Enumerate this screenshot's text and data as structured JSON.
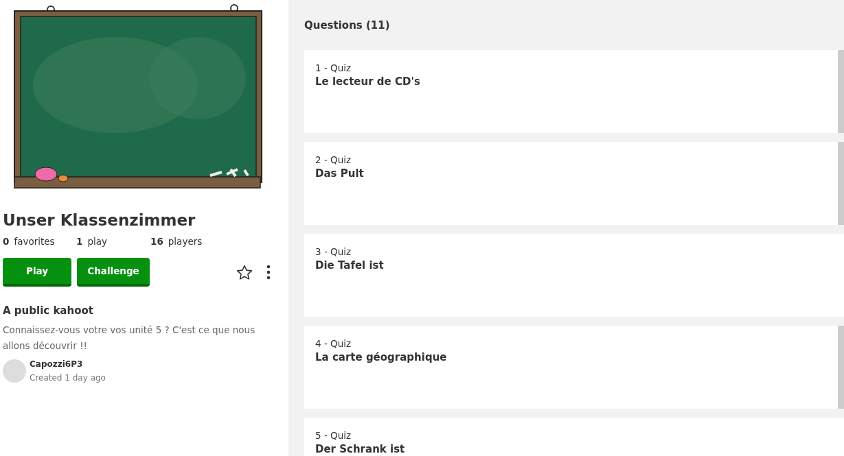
{
  "kahoot": {
    "title": "Unser Klassenzimmer",
    "stats": [
      {
        "count": "0",
        "label": "favorites"
      },
      {
        "count": "1",
        "label": "play"
      },
      {
        "count": "16",
        "label": "players"
      }
    ],
    "buttons": [
      "Play",
      "Challenge"
    ],
    "favorited": false,
    "visibility": "A public kahoot",
    "description": "Connaissez-vous votre vos unité 5 ? C'est ce que nous allons découvrir !!",
    "author": {
      "name": "Capozzi6P3",
      "created": "Created 1 day ago"
    }
  },
  "questions": {
    "heading": "Questions (11)",
    "items": [
      {
        "type": "1 - Quiz",
        "title": "Le lecteur de CD's",
        "thumbnail": true
      },
      {
        "type": "2 - Quiz",
        "title": "Das Pult",
        "thumbnail": true
      },
      {
        "type": "3 - Quiz",
        "title": "Die Tafel ist",
        "thumbnail": false
      },
      {
        "type": "4 - Quiz",
        "title": "La carte géographique",
        "thumbnail": true
      },
      {
        "type": "5 - Quiz",
        "title": "Der Schrank ist",
        "thumbnail": false
      }
    ]
  }
}
